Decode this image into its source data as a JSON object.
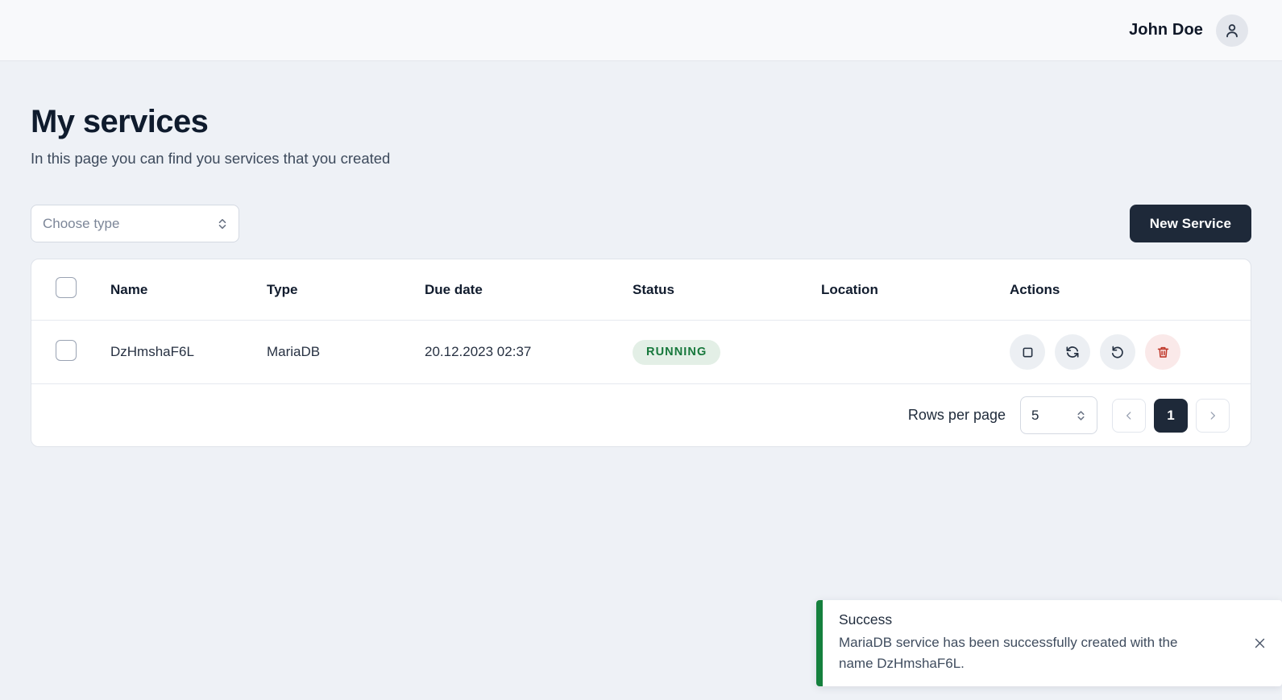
{
  "topbar": {
    "user_name": "John Doe",
    "avatar_icon": "user-icon"
  },
  "page": {
    "title": "My services",
    "subtitle": "In this page you can find you services that you created"
  },
  "toolbar": {
    "type_filter": {
      "placeholder": "Choose type",
      "value": "",
      "icon": "chevron-up-down-icon"
    },
    "new_service_label": "New Service"
  },
  "table": {
    "columns": [
      "Name",
      "Type",
      "Due date",
      "Status",
      "Location",
      "Actions"
    ],
    "rows": [
      {
        "name": "DzHmshaF6L",
        "type": "MariaDB",
        "due_date": "20.12.2023 02:37",
        "status": "RUNNING",
        "location": "",
        "actions": [
          "stop-button",
          "restart-button",
          "reload-button",
          "delete-button"
        ]
      }
    ]
  },
  "pagination": {
    "rows_per_page_label": "Rows per page",
    "rows_per_page_value": "5",
    "prev_label": "‹",
    "next_label": "›",
    "pages": [
      "1"
    ],
    "current_page": "1"
  },
  "toast": {
    "title": "Success",
    "message": "MariaDB service has been successfully created with the name DzHmshaF6L.",
    "close_icon": "close-icon",
    "accent_color": "#15803d"
  },
  "colors": {
    "page_background": "#eef1f6",
    "topbar_background": "#f8f9fb",
    "primary": "#1e2939",
    "status_running_text": "#17783c",
    "status_running_bg": "#e3efe6",
    "danger": "#c0392b"
  }
}
